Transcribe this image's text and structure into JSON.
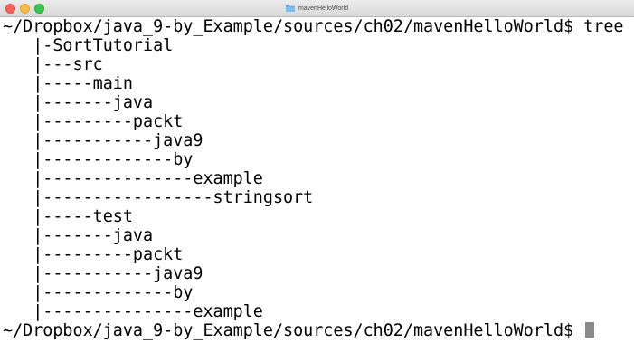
{
  "window": {
    "title": "mavenHelloWorld",
    "folder_icon": "folder-icon",
    "traffic_lights": {
      "close_color": "#fc605c",
      "minimize_color": "#fdbc40",
      "maximize_color": "#34c84a"
    }
  },
  "terminal": {
    "background_color": "#ffffff",
    "text_color": "#000000",
    "cursor_color": "#8a8a8a",
    "lines": [
      "~/Dropbox/java_9-by_Example/sources/ch02/mavenHelloWorld$ tree",
      "   |-SortTutorial",
      "   |---src",
      "   |-----main",
      "   |-------java",
      "   |---------packt",
      "   |-----------java9",
      "   |-------------by",
      "   |---------------example",
      "   |-----------------stringsort",
      "   |-----test",
      "   |-------java",
      "   |---------packt",
      "   |-----------java9",
      "   |-------------by",
      "   |---------------example"
    ],
    "prompt": "~/Dropbox/java_9-by_Example/sources/ch02/mavenHelloWorld$ "
  }
}
